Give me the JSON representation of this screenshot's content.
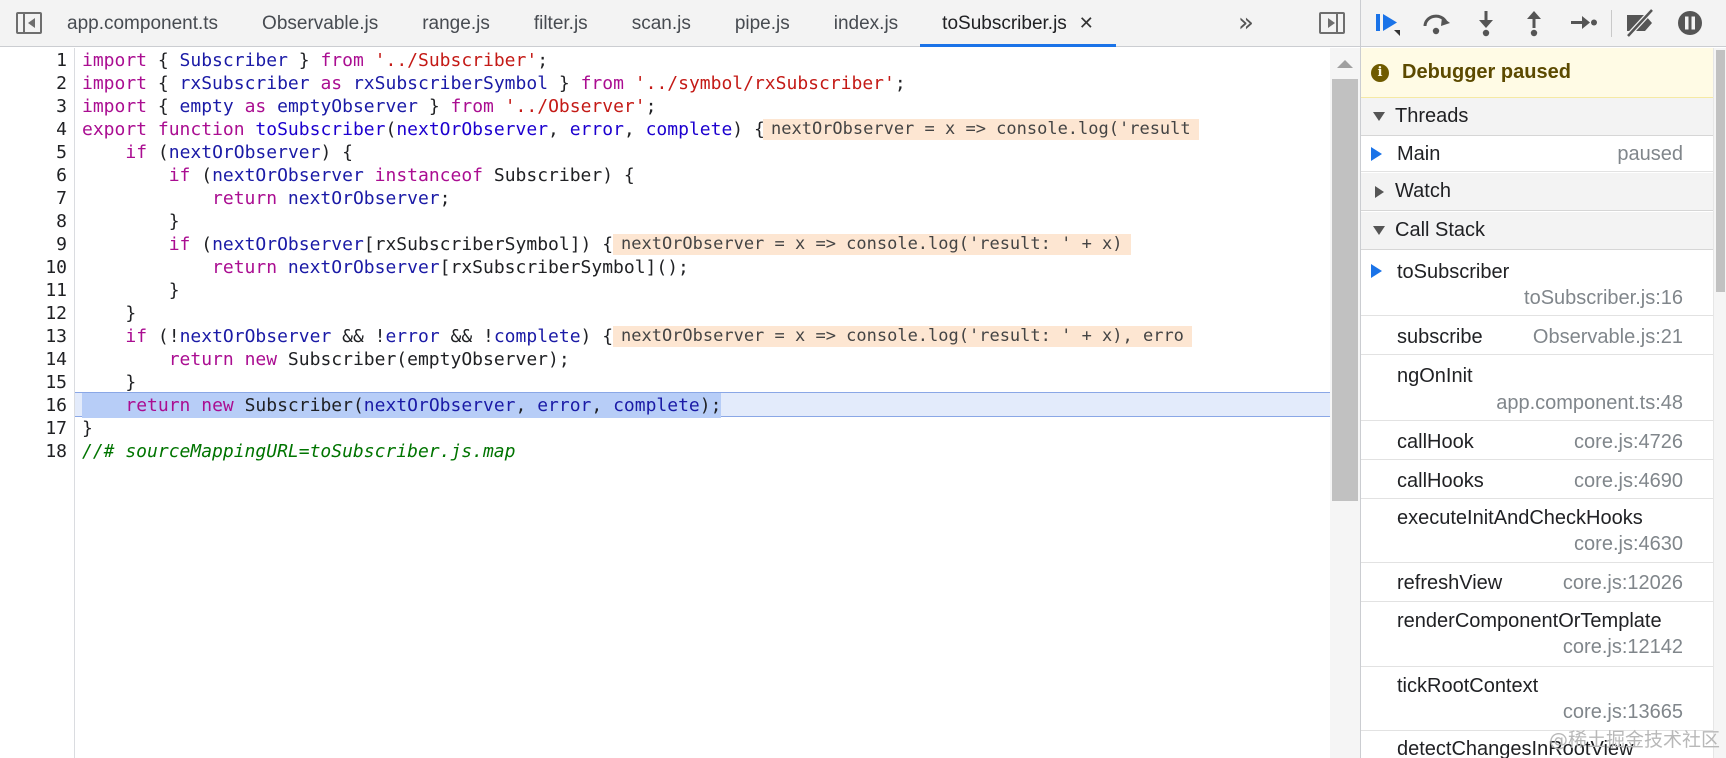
{
  "editor_tabs": [
    {
      "label": "app.component.ts"
    },
    {
      "label": "Observable.js"
    },
    {
      "label": "range.js"
    },
    {
      "label": "filter.js"
    },
    {
      "label": "scan.js"
    },
    {
      "label": "pipe.js"
    },
    {
      "label": "index.js"
    },
    {
      "label": "toSubscriber.js",
      "active": true,
      "close": "✕"
    }
  ],
  "more_tabs": "»",
  "code_lines": [
    {
      "n": "1"
    },
    {
      "n": "2"
    },
    {
      "n": "3"
    },
    {
      "n": "4"
    },
    {
      "n": "5"
    },
    {
      "n": "6"
    },
    {
      "n": "7"
    },
    {
      "n": "8"
    },
    {
      "n": "9"
    },
    {
      "n": "10"
    },
    {
      "n": "11"
    },
    {
      "n": "12"
    },
    {
      "n": "13"
    },
    {
      "n": "14"
    },
    {
      "n": "15"
    },
    {
      "n": "16"
    },
    {
      "n": "17"
    },
    {
      "n": "18"
    }
  ],
  "code": {
    "l1": [
      "import",
      " { ",
      "Subscriber",
      " } ",
      "from",
      " ",
      "'../Subscriber'",
      ";"
    ],
    "l2": [
      "import",
      " { ",
      "rxSubscriber",
      " ",
      "as",
      " ",
      "rxSubscriberSymbol",
      " } ",
      "from",
      " ",
      "'../symbol/rxSubscriber'",
      ";"
    ],
    "l3": [
      "import",
      " { ",
      "empty",
      " ",
      "as",
      " ",
      "emptyObserver",
      " } ",
      "from",
      " ",
      "'../Observer'",
      ";"
    ],
    "l4": [
      "export",
      " ",
      "function",
      " ",
      "toSubscriber",
      "(",
      "nextOrObserver",
      ", ",
      "error",
      ", ",
      "complete",
      ") {"
    ],
    "l5": [
      "    ",
      "if",
      " (",
      "nextOrObserver",
      ") {"
    ],
    "l6": [
      "        ",
      "if",
      " (",
      "nextOrObserver",
      " ",
      "instanceof",
      " Subscriber) {"
    ],
    "l7": [
      "            ",
      "return",
      " ",
      "nextOrObserver",
      ";"
    ],
    "l8": [
      "        }"
    ],
    "l9": [
      "        ",
      "if",
      " (",
      "nextOrObserver",
      "[rxSubscriberSymbol]) {"
    ],
    "l10": [
      "            ",
      "return",
      " ",
      "nextOrObserver",
      "[rxSubscriberSymbol]();"
    ],
    "l11": [
      "        }"
    ],
    "l12": [
      "    }"
    ],
    "l13": [
      "    ",
      "if",
      " (!",
      "nextOrObserver",
      " && !",
      "error",
      " && !",
      "complete",
      ") {"
    ],
    "l14": [
      "        ",
      "return",
      " ",
      "new",
      " Subscriber(emptyObserver);"
    ],
    "l15": [
      "    }"
    ],
    "l16": [
      "    ",
      "return",
      " ",
      "new",
      " Subscriber(",
      "nextOrObserver",
      ", ",
      "error",
      ", ",
      "complete",
      ");"
    ],
    "l17": [
      "}"
    ],
    "l18": [
      "//# sourceMappingURL=toSubscriber.js.map"
    ]
  },
  "inline_values": {
    "l4": "nextOrObserver = x => console.log('result",
    "l9": "nextOrObserver = x => console.log('result: ' + x)",
    "l13": "nextOrObserver = x => console.log('result: ' + x), erro"
  },
  "debugger": {
    "paused_icon": "i",
    "paused_message": "Debugger paused",
    "threads_title": "Threads",
    "thread": {
      "name": "Main",
      "status": "paused"
    },
    "watch_title": "Watch",
    "call_stack_title": "Call Stack",
    "frames": [
      {
        "name": "toSubscriber",
        "location": "toSubscriber.js:16",
        "current": true
      },
      {
        "name": "subscribe",
        "location": "Observable.js:21"
      },
      {
        "name": "ngOnInit",
        "location": "app.component.ts:48"
      },
      {
        "name": "callHook",
        "location": "core.js:4726"
      },
      {
        "name": "callHooks",
        "location": "core.js:4690"
      },
      {
        "name": "executeInitAndCheckHooks",
        "location": "core.js:4630"
      },
      {
        "name": "refreshView",
        "location": "core.js:12026"
      },
      {
        "name": "renderComponentOrTemplate",
        "location": "core.js:12142"
      },
      {
        "name": "tickRootContext",
        "location": "core.js:13665"
      },
      {
        "name": "detectChangesInRootView",
        "location": ""
      }
    ]
  },
  "watermark": "@稀土掘金技术社区",
  "colors": {
    "accent": "#1a73e8",
    "paused_bg": "#fffbe5",
    "exec_line": "#b7cdf7",
    "inline_value_bg": "#fde6d2"
  }
}
